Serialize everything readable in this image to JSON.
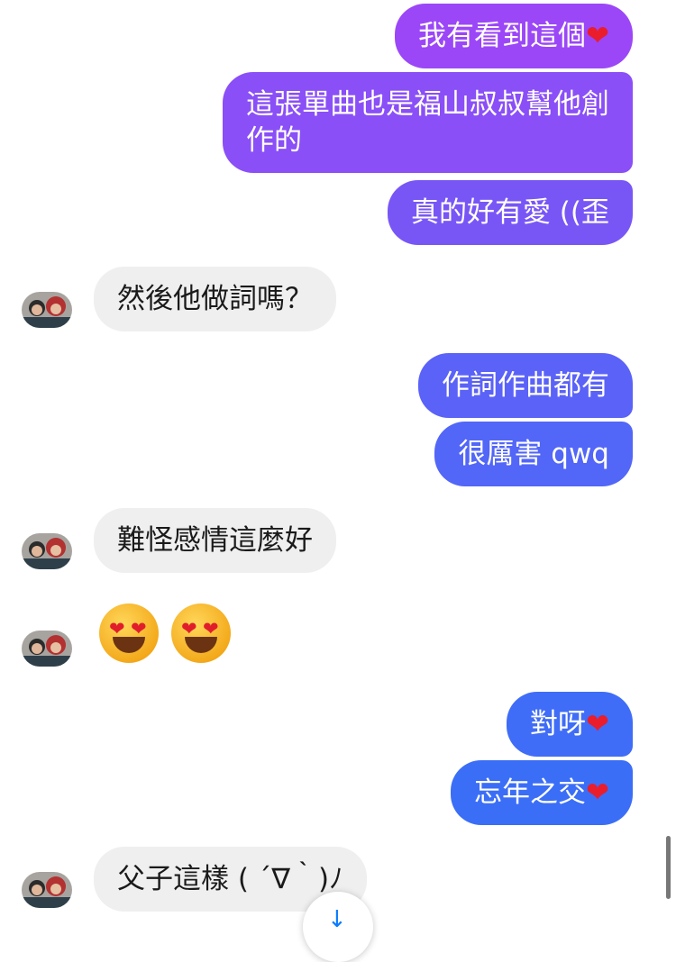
{
  "colors": {
    "outgoing_top": "#9e49f7",
    "outgoing_mid": "#6a5af6",
    "outgoing_bottom": "#3c6ef7",
    "incoming_bg": "#efefef",
    "heart": "#ea1d2c"
  },
  "icons": {
    "heart": "heart-icon",
    "emoji": "heart-eyes-emoji",
    "avatar": "user-avatar",
    "scroll": "arrow-down-icon"
  },
  "messages": [
    {
      "text": "我有看到這個",
      "heart": "❤"
    },
    {
      "line1": "這張單曲也是福山叔叔幫他創",
      "line2": "作的"
    },
    {
      "text": "真的好有愛 ((歪"
    },
    {
      "text": "然後他做詞嗎？"
    },
    {
      "text": "作詞作曲都有"
    },
    {
      "text": "很厲害 qwq"
    },
    {
      "text": "難怪感情這麼好"
    },
    {
      "emoji": "😍😍"
    },
    {
      "text": "對呀",
      "heart": "❤"
    },
    {
      "text": "忘年之交",
      "heart": "❤"
    },
    {
      "text": "父子這樣 ( ´∇｀)ﾉ"
    }
  ],
  "scroll_button": {
    "glyph": "↓"
  }
}
